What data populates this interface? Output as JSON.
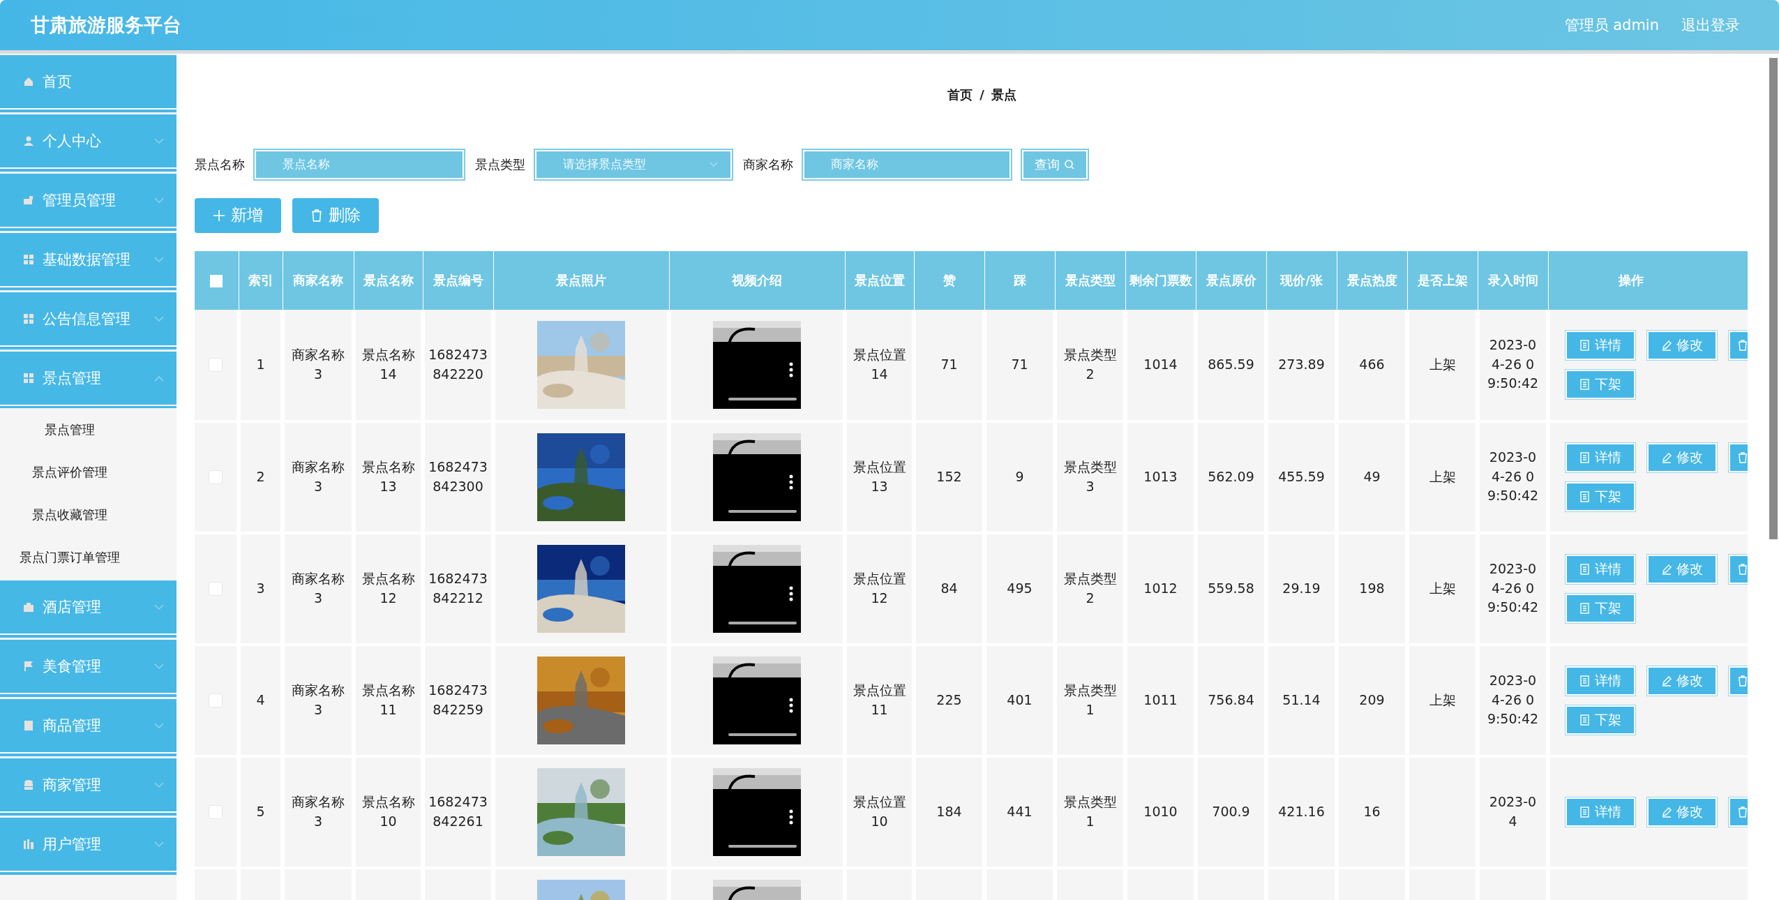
{
  "header": {
    "title": "甘肃旅游服务平台",
    "user": "管理员 admin",
    "logout": "退出登录"
  },
  "sidebar": {
    "items": [
      {
        "label": "首页"
      },
      {
        "label": "个人中心",
        "expanded": false
      },
      {
        "label": "管理员管理",
        "expanded": false
      },
      {
        "label": "基础数据管理",
        "expanded": false
      },
      {
        "label": "公告信息管理",
        "expanded": false
      },
      {
        "label": "景点管理",
        "expanded": true,
        "children": [
          {
            "label": "景点管理"
          },
          {
            "label": "景点评价管理"
          },
          {
            "label": "景点收藏管理"
          },
          {
            "label": "景点门票订单管理"
          }
        ]
      },
      {
        "label": "酒店管理",
        "expanded": false
      },
      {
        "label": "美食管理",
        "expanded": false
      },
      {
        "label": "商品管理",
        "expanded": false
      },
      {
        "label": "商家管理",
        "expanded": false
      },
      {
        "label": "用户管理",
        "expanded": false
      }
    ]
  },
  "breadcrumb": [
    "首页",
    "/",
    "景点"
  ],
  "search": {
    "fields": [
      {
        "label": "景点名称",
        "kind": "input",
        "placeholder": "景点名称"
      },
      {
        "label": "景点类型",
        "kind": "select",
        "placeholder": "请选择景点类型"
      },
      {
        "label": "商家名称",
        "kind": "input",
        "placeholder": "商家名称"
      }
    ],
    "button": "查询"
  },
  "actions": [
    {
      "kind": "add",
      "label": "新增"
    },
    {
      "kind": "delete",
      "label": "删除"
    }
  ],
  "table": {
    "select_all_checked": false,
    "columns": [
      "索引",
      "商家名称",
      "景点名称",
      "景点编号",
      "景点照片",
      "视频介绍",
      "景点位置",
      "赞",
      "踩",
      "景点类型",
      "剩余门票数",
      "景点原价",
      "现价/张",
      "景点热度",
      "是否上架",
      "录入时间",
      "操作"
    ],
    "rows": [
      {
        "checked": false,
        "cells": [
          "1",
          "商家名称3",
          "景点名称14",
          "1682473842220",
          {
            "kind": "picture"
          },
          {
            "kind": "picture"
          },
          "景点位置14",
          "71",
          "71",
          "景点类型2",
          "1014",
          "865.59",
          "273.89",
          "466",
          "上架",
          "2023-04-26 09:50:42"
        ],
        "buttons": [
          {
            "kind": "detail",
            "label": "详情"
          },
          {
            "kind": "edit",
            "label": "修改"
          },
          {
            "kind": "trash"
          },
          {
            "kind": "detail",
            "label": "下架"
          }
        ]
      },
      {
        "checked": false,
        "cells": [
          "2",
          "商家名称3",
          "景点名称13",
          "1682473842300",
          {
            "kind": "picture"
          },
          {
            "kind": "picture"
          },
          "景点位置13",
          "152",
          "9",
          "景点类型3",
          "1013",
          "562.09",
          "455.59",
          "49",
          "上架",
          "2023-04-26 09:50:42"
        ],
        "buttons": [
          {
            "kind": "detail",
            "label": "详情"
          },
          {
            "kind": "edit",
            "label": "修改"
          },
          {
            "kind": "trash"
          },
          {
            "kind": "detail",
            "label": "下架"
          }
        ]
      },
      {
        "checked": false,
        "cells": [
          "3",
          "商家名称3",
          "景点名称12",
          "1682473842212",
          {
            "kind": "picture"
          },
          {
            "kind": "picture"
          },
          "景点位置12",
          "84",
          "495",
          "景点类型2",
          "1012",
          "559.58",
          "29.19",
          "198",
          "上架",
          "2023-04-26 09:50:42"
        ],
        "buttons": [
          {
            "kind": "detail",
            "label": "详情"
          },
          {
            "kind": "edit",
            "label": "修改"
          },
          {
            "kind": "trash"
          },
          {
            "kind": "detail",
            "label": "下架"
          }
        ]
      },
      {
        "checked": false,
        "cells": [
          "4",
          "商家名称3",
          "景点名称11",
          "1682473842259",
          {
            "kind": "picture"
          },
          {
            "kind": "picture"
          },
          "景点位置11",
          "225",
          "401",
          "景点类型1",
          "1011",
          "756.84",
          "51.14",
          "209",
          "上架",
          "2023-04-26 09:50:42"
        ],
        "buttons": [
          {
            "kind": "detail",
            "label": "详情"
          },
          {
            "kind": "edit",
            "label": "修改"
          },
          {
            "kind": "trash"
          },
          {
            "kind": "detail",
            "label": "下架"
          }
        ]
      },
      {
        "checked": false,
        "cells": [
          "5",
          "商家名称3",
          "景点名称10",
          "1682473842261",
          {
            "kind": "picture"
          },
          {
            "kind": "picture"
          },
          "景点位置10",
          "184",
          "441",
          "景点类型1",
          "1010",
          "700.9",
          "421.16",
          "16",
          null,
          "2023-04"
        ],
        "buttons": [
          {
            "kind": "detail",
            "label": "详情"
          },
          {
            "kind": "edit",
            "label": "修改"
          },
          {
            "kind": "trash"
          }
        ]
      },
      {
        "cells": [
          null,
          null,
          null,
          null,
          {
            "kind": "picture"
          },
          {
            "kind": "picture"
          }
        ]
      }
    ]
  }
}
